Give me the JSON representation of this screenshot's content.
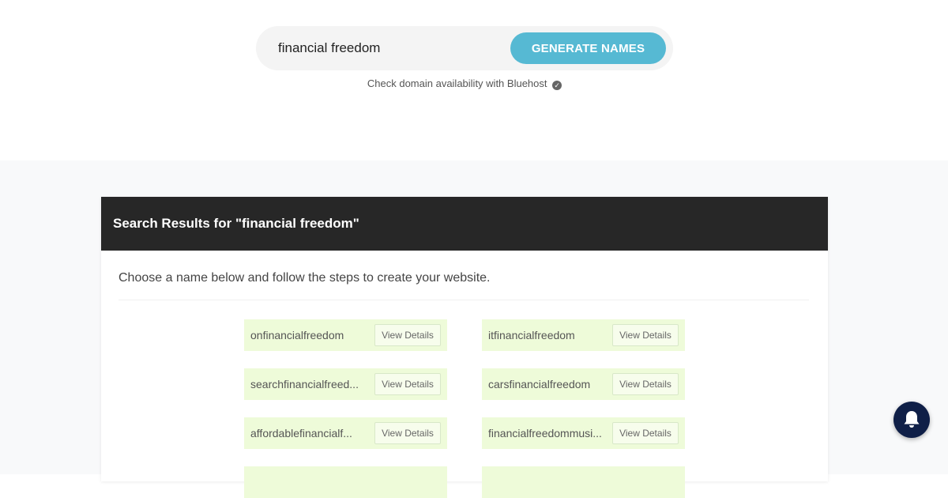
{
  "search": {
    "value": "financial freedom",
    "button_label": "GENERATE NAMES",
    "availability_note": "Check domain availability with Bluehost",
    "check_icon": "check-circle-icon"
  },
  "results": {
    "header": "Search Results for \"financial freedom\"",
    "intro": "Choose a name below and follow the steps to create your website.",
    "names": [
      {
        "name": "onfinancialfreedom",
        "action": "View Details"
      },
      {
        "name": "itfinancialfreedom",
        "action": "View Details"
      },
      {
        "name": "searchfinancialfreed...",
        "action": "View Details"
      },
      {
        "name": "carsfinancialfreedom",
        "action": "View Details"
      },
      {
        "name": "affordablefinancialf...",
        "action": "View Details"
      },
      {
        "name": "financialfreedommusi...",
        "action": "View Details"
      }
    ]
  },
  "notifications": {
    "icon": "bell-icon"
  },
  "colors": {
    "accent": "#56b9d3",
    "header_bg": "#272727",
    "result_bg": "#eefbd9",
    "bell_bg": "#0f1f47"
  }
}
